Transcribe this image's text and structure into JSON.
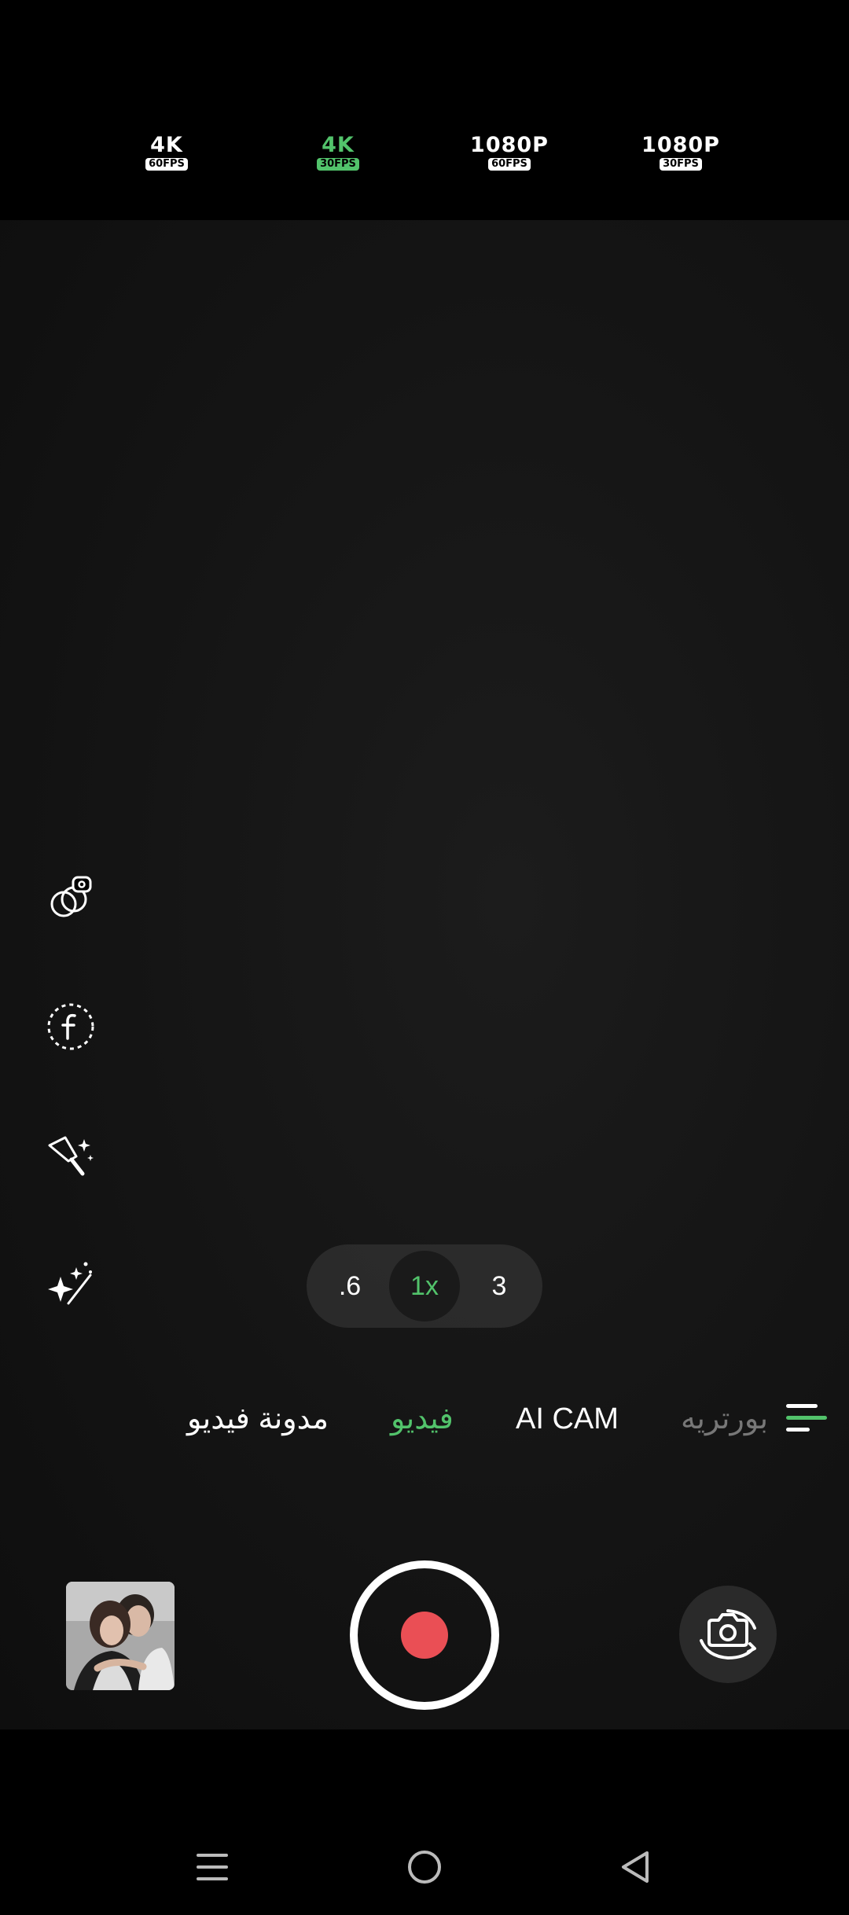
{
  "resolutions": [
    {
      "main": "4K",
      "fps": "60FPS",
      "selected": false
    },
    {
      "main": "4K",
      "fps": "30FPS",
      "selected": true
    },
    {
      "main": "1080P",
      "fps": "60FPS",
      "selected": false
    },
    {
      "main": "1080P",
      "fps": "30FPS",
      "selected": false
    }
  ],
  "tools": [
    {
      "icon": "filter-icon"
    },
    {
      "icon": "flash-f-icon"
    },
    {
      "icon": "beauty-wand-icon"
    },
    {
      "icon": "ai-sparkle-icon"
    }
  ],
  "zoom": {
    "options": [
      ".6",
      "1x",
      "3"
    ],
    "selected": "1x"
  },
  "modes": [
    {
      "label": "مدونة فيديو",
      "state": "normal"
    },
    {
      "label": "فيديو",
      "state": "active"
    },
    {
      "label": "AI CAM",
      "state": "normal"
    },
    {
      "label": "بورتريه",
      "state": "dim"
    }
  ],
  "more_menu_icon": "more-modes-menu-icon",
  "gallery": {
    "icon": "gallery-thumbnail"
  },
  "record": {
    "icon": "record-icon"
  },
  "flip": {
    "icon": "switch-camera-icon"
  },
  "nav": [
    {
      "icon": "recent-apps-icon"
    },
    {
      "icon": "home-icon"
    },
    {
      "icon": "back-icon"
    }
  ],
  "colors": {
    "accent": "#52c36b",
    "record": "#ea4f55",
    "background": "#000000"
  }
}
